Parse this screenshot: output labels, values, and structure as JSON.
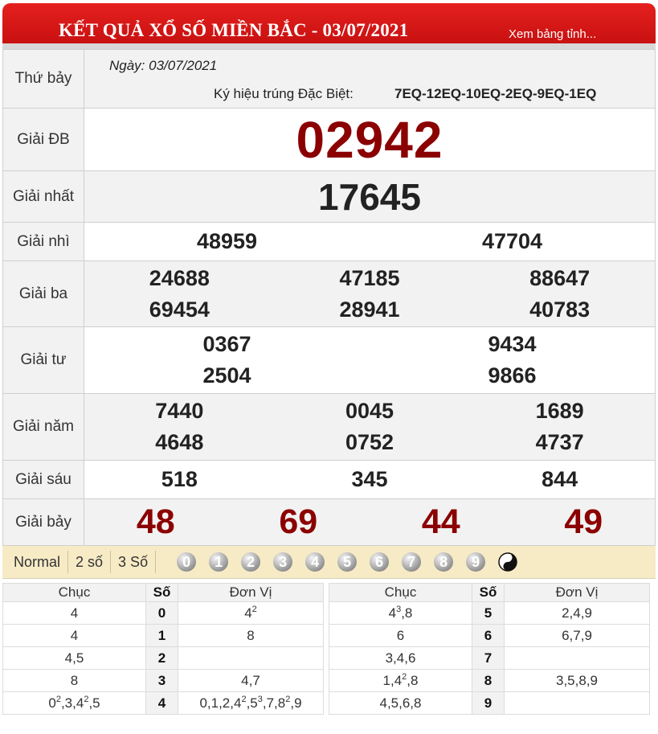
{
  "header": {
    "title": "KẾT QUẢ XỔ SỐ MIỀN BẮC - 03/07/2021",
    "more_link": "Xem bảng tỉnh..."
  },
  "info": {
    "weekday": "Thứ bảy",
    "date_label": "Ngày: 03/07/2021",
    "symbol_label": "Ký hiệu trúng Đặc Biệt:",
    "symbol_value": "7EQ-12EQ-10EQ-2EQ-9EQ-1EQ"
  },
  "prizes": {
    "db": {
      "label": "Giải ĐB",
      "numbers": [
        "02942"
      ]
    },
    "nhat": {
      "label": "Giải nhất",
      "numbers": [
        "17645"
      ]
    },
    "nhi": {
      "label": "Giải nhì",
      "numbers": [
        "48959",
        "47704"
      ]
    },
    "ba": {
      "label": "Giải ba",
      "numbers": [
        "24688",
        "47185",
        "88647",
        "69454",
        "28941",
        "40783"
      ]
    },
    "tu": {
      "label": "Giải tư",
      "numbers": [
        "0367",
        "9434",
        "2504",
        "9866"
      ]
    },
    "nam": {
      "label": "Giải năm",
      "numbers": [
        "7440",
        "0045",
        "1689",
        "4648",
        "0752",
        "4737"
      ]
    },
    "sau": {
      "label": "Giải sáu",
      "numbers": [
        "518",
        "345",
        "844"
      ]
    },
    "bay": {
      "label": "Giải bảy",
      "numbers": [
        "48",
        "69",
        "44",
        "49"
      ]
    }
  },
  "filter": {
    "options": [
      "Normal",
      "2 số",
      "3 Số"
    ],
    "digits": [
      "0",
      "1",
      "2",
      "3",
      "4",
      "5",
      "6",
      "7",
      "8",
      "9"
    ],
    "extra_icon": "yin-yang-icon"
  },
  "loto": {
    "headers": {
      "chuc": "Chục",
      "so": "Số",
      "donvi": "Đơn Vị"
    },
    "left": [
      {
        "chuc": "4",
        "so": "0",
        "donvi": "4<sup>2</sup>"
      },
      {
        "chuc": "4",
        "so": "1",
        "donvi": "8"
      },
      {
        "chuc": "4,5",
        "so": "2",
        "donvi": ""
      },
      {
        "chuc": "8",
        "so": "3",
        "donvi": "4,7"
      },
      {
        "chuc": "0<sup>2</sup>,3,4<sup>2</sup>,5",
        "so": "4",
        "donvi": "0,1,2,4<sup>2</sup>,5<sup>3</sup>,7,8<sup>2</sup>,9"
      }
    ],
    "right": [
      {
        "chuc": "4<sup>3</sup>,8",
        "so": "5",
        "donvi": "2,4,9"
      },
      {
        "chuc": "6",
        "so": "6",
        "donvi": "6,7,9"
      },
      {
        "chuc": "3,4,6",
        "so": "7",
        "donvi": ""
      },
      {
        "chuc": "1,4<sup>2</sup>,8",
        "so": "8",
        "donvi": "3,5,8,9"
      },
      {
        "chuc": "4,5,6,8",
        "so": "9",
        "donvi": ""
      }
    ]
  },
  "colors": {
    "header_red": "#d31414",
    "prize_red": "#8b0000",
    "filter_bg": "#f7ebc6"
  }
}
